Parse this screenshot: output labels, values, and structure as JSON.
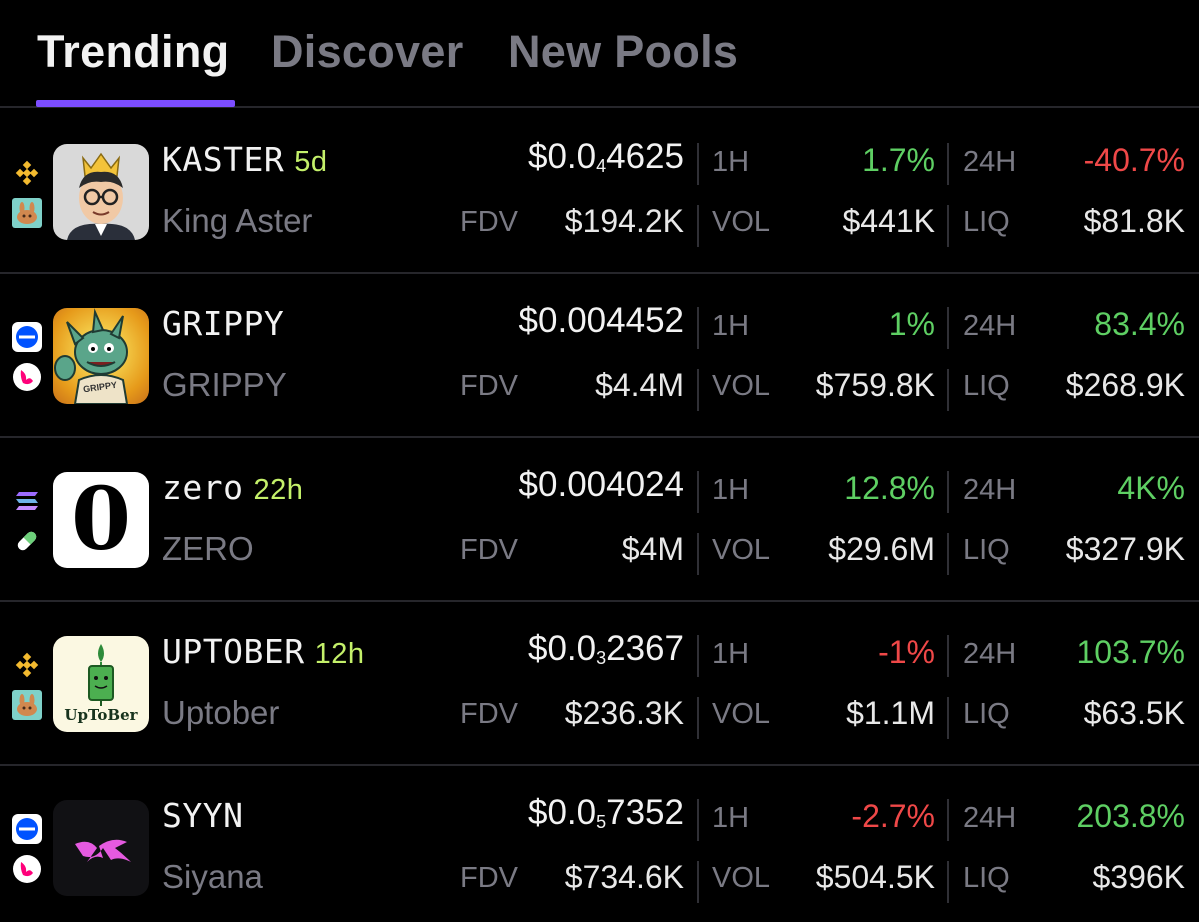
{
  "tabs": [
    {
      "label": "Trending",
      "active": true
    },
    {
      "label": "Discover",
      "active": false
    },
    {
      "label": "New Pools",
      "active": false
    }
  ],
  "labels": {
    "h1": "1H",
    "h24": "24H",
    "fdv": "FDV",
    "vol": "VOL",
    "liq": "LIQ"
  },
  "colors": {
    "accent": "#7c4dff",
    "positive": "#5ecf63",
    "negative": "#ef4848",
    "age": "#c4f06a"
  },
  "tokens": [
    {
      "symbol": "KASTER",
      "age": "5d",
      "name": "King Aster",
      "price_prefix": "$0.0",
      "price_sub": "4",
      "price_rest": "4625",
      "change_1h": "1.7%",
      "change_1h_dir": "up",
      "change_24h": "-40.7%",
      "change_24h_dir": "down",
      "fdv": "$194.2K",
      "vol": "$441K",
      "liq": "$81.8K",
      "chains": [
        "bnb-chain-icon",
        "pancakeswap-icon"
      ],
      "avatar": "king-aster-avatar"
    },
    {
      "symbol": "GRIPPY",
      "age": "",
      "name": "GRIPPY",
      "price_prefix": "$0.004452",
      "price_sub": "",
      "price_rest": "",
      "change_1h": "1%",
      "change_1h_dir": "up",
      "change_24h": "83.4%",
      "change_24h_dir": "up",
      "fdv": "$4.4M",
      "vol": "$759.8K",
      "liq": "$268.9K",
      "chains": [
        "base-chain-icon",
        "uniswap-icon"
      ],
      "avatar": "grippy-avatar",
      "avatar_text": "GRIPPY"
    },
    {
      "symbol": "zero",
      "age": "22h",
      "name": "ZERO",
      "price_prefix": "$0.004024",
      "price_sub": "",
      "price_rest": "",
      "change_1h": "12.8%",
      "change_1h_dir": "up",
      "change_24h": "4K%",
      "change_24h_dir": "up",
      "fdv": "$4M",
      "vol": "$29.6M",
      "liq": "$327.9K",
      "chains": [
        "solana-chain-icon",
        "pill-icon"
      ],
      "avatar": "zero-avatar",
      "avatar_text": "0"
    },
    {
      "symbol": "UPTOBER",
      "age": "12h",
      "name": "Uptober",
      "price_prefix": "$0.0",
      "price_sub": "3",
      "price_rest": "2367",
      "change_1h": "-1%",
      "change_1h_dir": "down",
      "change_24h": "103.7%",
      "change_24h_dir": "up",
      "fdv": "$236.3K",
      "vol": "$1.1M",
      "liq": "$63.5K",
      "chains": [
        "bnb-chain-icon",
        "pancakeswap-icon"
      ],
      "avatar": "uptober-avatar",
      "avatar_text": "UpToBer"
    },
    {
      "symbol": "SYYN",
      "age": "",
      "name": "Siyana",
      "price_prefix": "$0.0",
      "price_sub": "5",
      "price_rest": "7352",
      "change_1h": "-2.7%",
      "change_1h_dir": "down",
      "change_24h": "203.8%",
      "change_24h_dir": "up",
      "fdv": "$734.6K",
      "vol": "$504.5K",
      "liq": "$396K",
      "chains": [
        "base-chain-icon",
        "uniswap-icon"
      ],
      "avatar": "siyana-avatar"
    }
  ]
}
